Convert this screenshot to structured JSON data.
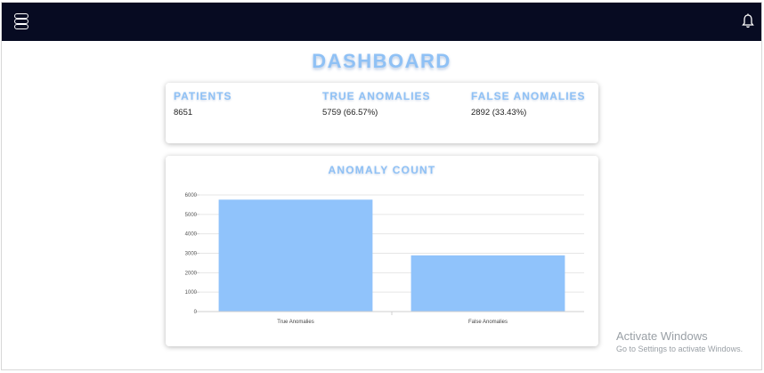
{
  "header": {
    "menu_icon": "hamburger-menu-icon",
    "bell_icon": "notification-bell-icon",
    "background": "#070b22"
  },
  "page": {
    "title": "DASHBOARD",
    "accent_color": "#8fc1f5"
  },
  "stats": [
    {
      "label": "PATIENTS",
      "value": "8651"
    },
    {
      "label": "TRUE ANOMALIES",
      "value": "5759 (66.57%)"
    },
    {
      "label": "FALSE ANOMALIES",
      "value": "2892 (33.43%)"
    }
  ],
  "chart_data": {
    "type": "bar",
    "title": "ANOMALY COUNT",
    "categories": [
      "True Anomalies",
      "False Anomalies"
    ],
    "values": [
      5759,
      2892
    ],
    "ylim": [
      0,
      6000
    ],
    "yticks": [
      "0",
      "1000",
      "2000",
      "3000",
      "4000",
      "5000",
      "6000"
    ],
    "grid": true,
    "bar_color": "#90c3fb"
  },
  "watermark": {
    "title": "Activate Windows",
    "subtitle": "Go to Settings to activate Windows."
  }
}
